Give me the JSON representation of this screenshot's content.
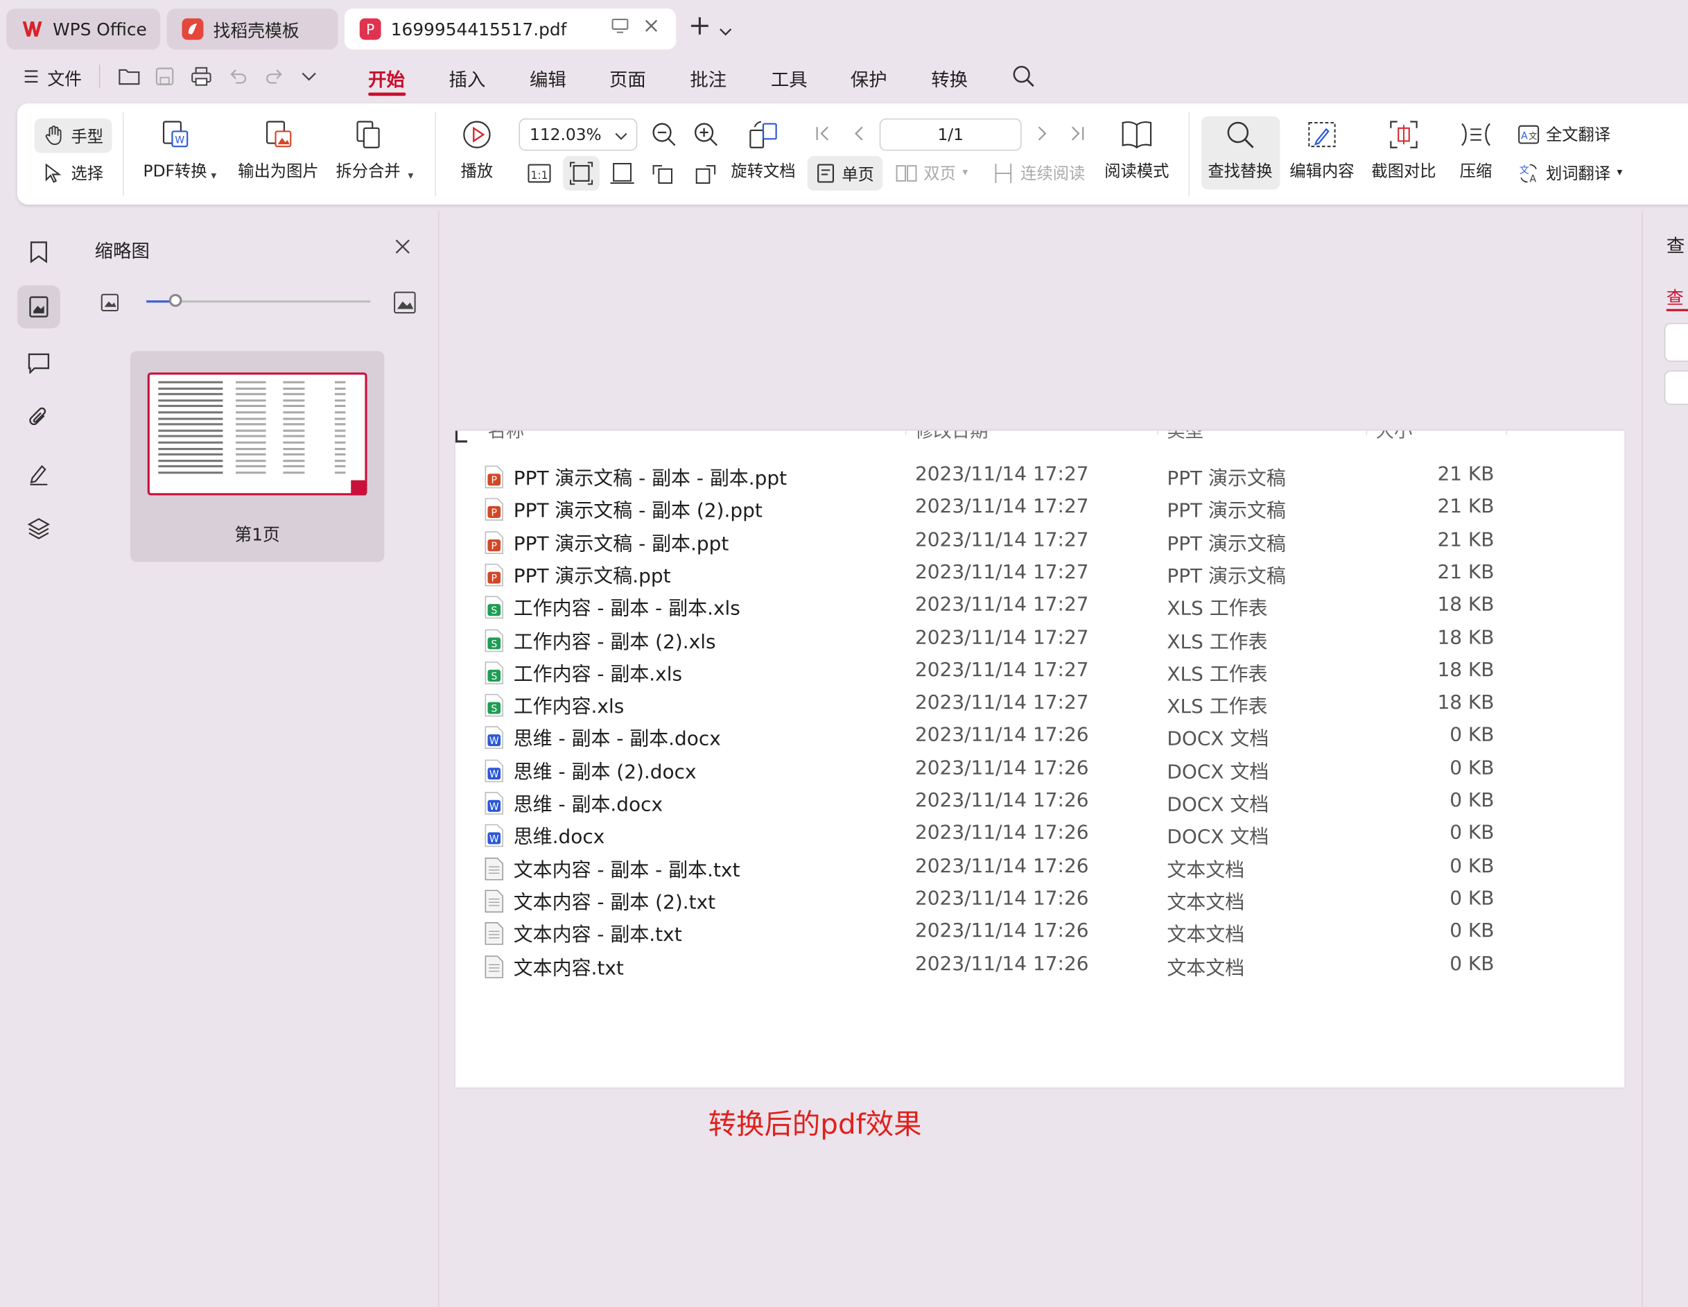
{
  "tabs": {
    "wps": "WPS Office",
    "template": "找稻壳模板",
    "doc": "1699954415517.pdf"
  },
  "menu": {
    "file": "文件",
    "tabs": [
      "开始",
      "插入",
      "编辑",
      "页面",
      "批注",
      "工具",
      "保护",
      "转换"
    ]
  },
  "ribbon": {
    "hand": "手型",
    "select": "选择",
    "pdf_convert": "PDF转换",
    "export_image": "输出为图片",
    "split_merge": "拆分合并",
    "play": "播放",
    "zoom": "112.03%",
    "rotate": "旋转文档",
    "single": "单页",
    "double": "双页",
    "continuous": "连续阅读",
    "page": "1/1",
    "read_mode": "阅读模式",
    "find_replace": "查找替换",
    "edit_content": "编辑内容",
    "screenshot_compare": "截图对比",
    "compress": "压缩",
    "full_translate": "全文翻译",
    "word_translate": "划词翻译"
  },
  "thumb_panel": {
    "title": "缩略图",
    "page_label": "第1页",
    "zoom_level": 0.13
  },
  "right_panel": {
    "title": "查",
    "tab": "查"
  },
  "document": {
    "headers": [
      "名称",
      "修改日期",
      "类型",
      "大小"
    ],
    "rows": [
      {
        "kind": "ppt",
        "name": "PPT 演示文稿 - 副本 - 副本.ppt",
        "date": "2023/11/14 17:27",
        "type": "PPT 演示文稿",
        "size": "21 KB"
      },
      {
        "kind": "ppt",
        "name": "PPT 演示文稿 - 副本 (2).ppt",
        "date": "2023/11/14 17:27",
        "type": "PPT 演示文稿",
        "size": "21 KB"
      },
      {
        "kind": "ppt",
        "name": "PPT 演示文稿 - 副本.ppt",
        "date": "2023/11/14 17:27",
        "type": "PPT 演示文稿",
        "size": "21 KB"
      },
      {
        "kind": "ppt",
        "name": "PPT 演示文稿.ppt",
        "date": "2023/11/14 17:27",
        "type": "PPT 演示文稿",
        "size": "21 KB"
      },
      {
        "kind": "xls",
        "name": "工作内容 - 副本 - 副本.xls",
        "date": "2023/11/14 17:27",
        "type": "XLS 工作表",
        "size": "18 KB"
      },
      {
        "kind": "xls",
        "name": "工作内容 - 副本 (2).xls",
        "date": "2023/11/14 17:27",
        "type": "XLS 工作表",
        "size": "18 KB"
      },
      {
        "kind": "xls",
        "name": "工作内容 - 副本.xls",
        "date": "2023/11/14 17:27",
        "type": "XLS 工作表",
        "size": "18 KB"
      },
      {
        "kind": "xls",
        "name": "工作内容.xls",
        "date": "2023/11/14 17:27",
        "type": "XLS 工作表",
        "size": "18 KB"
      },
      {
        "kind": "docx",
        "name": "思维 - 副本 - 副本.docx",
        "date": "2023/11/14 17:26",
        "type": "DOCX 文档",
        "size": "0 KB"
      },
      {
        "kind": "docx",
        "name": "思维 - 副本 (2).docx",
        "date": "2023/11/14 17:26",
        "type": "DOCX 文档",
        "size": "0 KB"
      },
      {
        "kind": "docx",
        "name": "思维 - 副本.docx",
        "date": "2023/11/14 17:26",
        "type": "DOCX 文档",
        "size": "0 KB"
      },
      {
        "kind": "docx",
        "name": "思维.docx",
        "date": "2023/11/14 17:26",
        "type": "DOCX 文档",
        "size": "0 KB"
      },
      {
        "kind": "txt",
        "name": "文本内容 - 副本 - 副本.txt",
        "date": "2023/11/14 17:26",
        "type": "文本文档",
        "size": "0 KB"
      },
      {
        "kind": "txt",
        "name": "文本内容 - 副本 (2).txt",
        "date": "2023/11/14 17:26",
        "type": "文本文档",
        "size": "0 KB"
      },
      {
        "kind": "txt",
        "name": "文本内容 - 副本.txt",
        "date": "2023/11/14 17:26",
        "type": "文本文档",
        "size": "0 KB"
      },
      {
        "kind": "txt",
        "name": "文本内容.txt",
        "date": "2023/11/14 17:26",
        "type": "文本文档",
        "size": "0 KB"
      }
    ]
  },
  "caption": "转换后的pdf效果",
  "colors": {
    "accent": "#c8102e",
    "caption": "#e0201b",
    "ppt": "#d24726",
    "xls": "#1f9d55",
    "docx": "#2b57d8",
    "txt": "#9a9a9a"
  }
}
